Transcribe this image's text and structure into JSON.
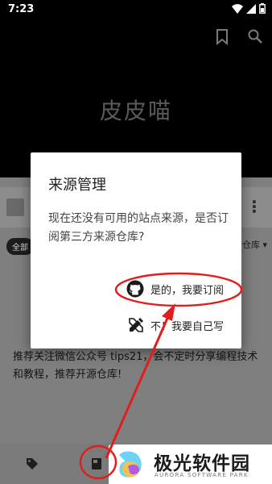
{
  "status_bar": {
    "time": "7:23"
  },
  "header": {
    "app_title": "皮皮喵"
  },
  "background": {
    "chip_all": "全部",
    "sort_label": "仓库",
    "tip_text": "推荐关注微信公众号 tips21，会不定时分享编程技术和教程，推荐开源仓库!"
  },
  "dialog": {
    "title": "来源管理",
    "message": "现在还没有可用的站点来源，是否订阅第三方来源仓库?",
    "action_subscribe": "是的，我要订阅",
    "action_self": "不！我要自己写"
  },
  "watermark": {
    "title": "极光软件园",
    "subtitle": "AURORA SOFTWARE PARK"
  },
  "colors": {
    "annotation": "#e11d1d",
    "dim_overlay": "#7f7f7f"
  }
}
